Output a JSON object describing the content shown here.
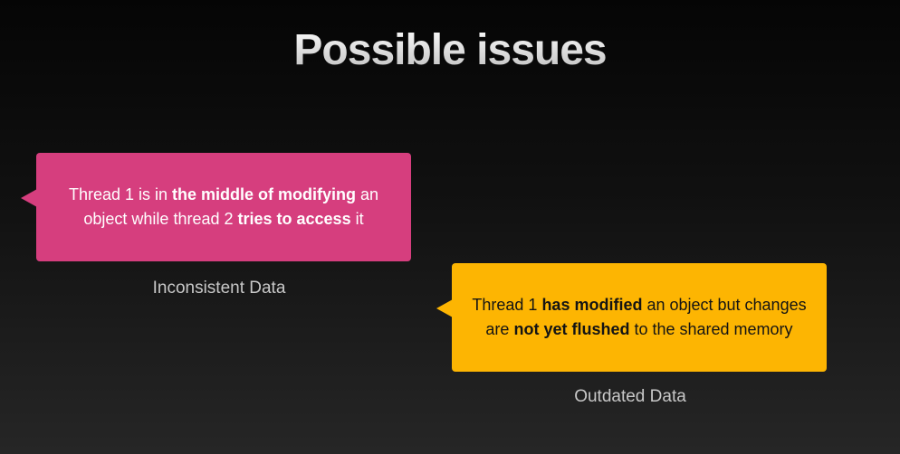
{
  "slide": {
    "title": "Possible issues"
  },
  "issues": [
    {
      "caption": "Inconsistent Data",
      "color": "#d63e7e",
      "text": {
        "t1": "Thread 1 is in ",
        "b1": "the middle of modifying",
        "t2": " an object while thread 2 ",
        "b2": "tries to access",
        "t3": " it"
      }
    },
    {
      "caption": "Outdated Data",
      "color": "#fdb502",
      "text": {
        "t1": "Thread 1 ",
        "b1": "has modified",
        "t2": " an object but changes are ",
        "b2": "not yet flushed",
        "t3": " to the shared memory"
      }
    }
  ]
}
